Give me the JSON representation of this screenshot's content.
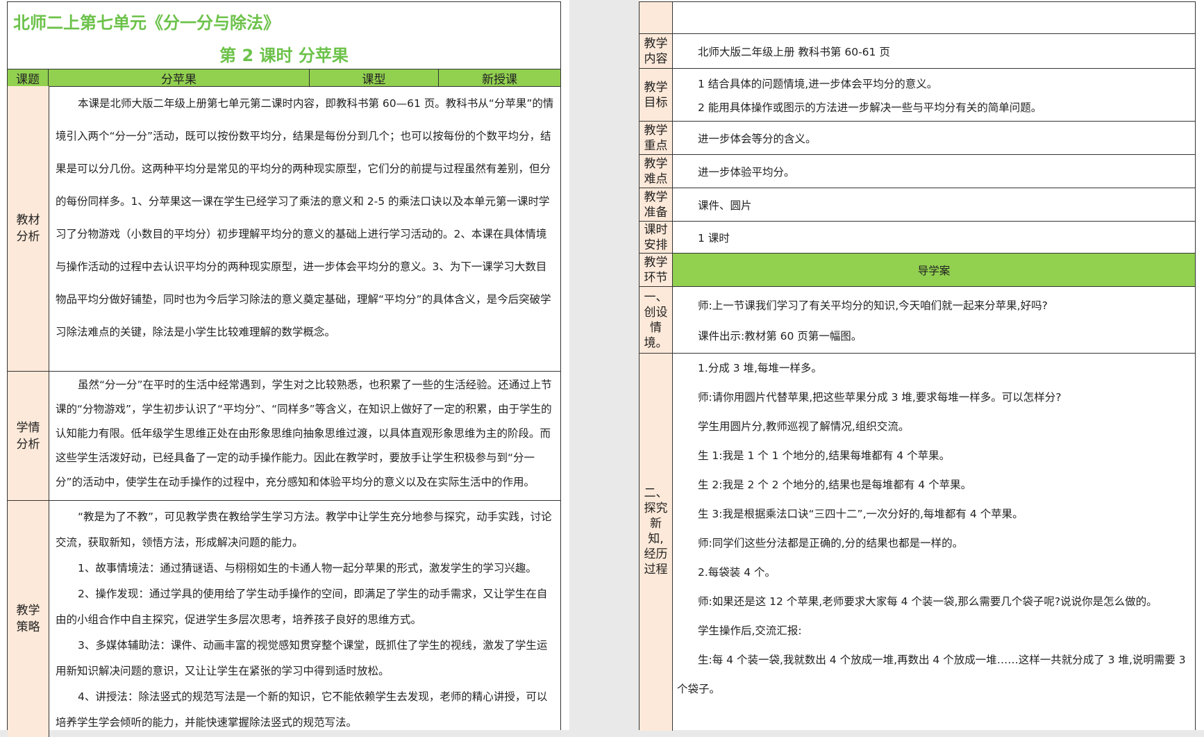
{
  "left": {
    "doc_title": "北师二上第七单元《分一分与除法》",
    "lesson_title": "第 2 课时  分苹果",
    "header": {
      "topic_label": "课题",
      "topic_value": "分苹果",
      "type_label": "课型",
      "type_value": "新授课"
    },
    "material": {
      "label": "教材\n分析",
      "text": "本课是北师大版二年级上册第七单元第二课时内容，即教科书第 60—61 页。教科书从“分苹果”的情境引入两个“分一分”活动，既可以按份数平均分，结果是每份分到几个；也可以按每份的个数平均分，结果是可以分几份。这两种平均分是常见的平均分的两种现实原型，它们分的前提与过程虽然有差别，但分的每份同样多。1、分苹果这一课在学生已经学习了乘法的意义和 2-5 的乘法口诀以及本单元第一课时学习了分物游戏（小数目的平均分）初步理解平均分的意义的基础上进行学习活动的。2、本课在具体情境与操作活动的过程中去认识平均分的两种现实原型，进一步体会平均分的意义。3、为下一课学习大数目物品平均分做好铺垫，同时也为今后学习除法的意义奠定基础，理解“平均分”的具体含义，是今后突破学习除法难点的关键，除法是小学生比较难理解的数学概念。"
    },
    "students": {
      "label": "学情\n分析",
      "text": "虽然“分一分”在平时的生活中经常遇到，学生对之比较熟悉，也积累了一些的生活经验。还通过上节课的“分物游戏”，学生初步认识了“平均分”、“同样多”等含义，在知识上做好了一定的积累，由于学生的认知能力有限。低年级学生思维正处在由形象思维向抽象思维过渡，以具体直观形象思维为主的阶段。而这些学生活泼好动，已经具备了一定的动手操作能力。因此在教学时，要放手让学生积极参与到“分一分”的活动中，使学生在动手操作的过程中，充分感知和体验平均分的意义以及在实际生活中的作用。"
    },
    "strategy": {
      "label": "教学\n策略",
      "paragraphs": [
        "“教是为了不教”，可见教学贵在教给学生学习方法。教学中让学生充分地参与探究，动手实践，讨论交流，获取新知，领悟方法，形成解决问题的能力。",
        "1、故事情境法：通过猜谜语、与栩栩如生的卡通人物一起分苹果的形式，激发学生的学习兴趣。",
        "2、操作发现：通过学具的使用给了学生动手操作的空间，即满足了学生的动手需求，又让学生在自由的小组合作中自主探究，促进学生多层次思考，培养孩子良好的思维方式。",
        "3、多媒体辅助法：课件、动画丰富的视觉感知贯穿整个课堂，既抓住了学生的视线，激发了学生运用新知识解决问题的意识，又让让学生在紧张的学习中得到适时放松。",
        "4、讲授法：除法竖式的规范写法是一个新的知识，它不能依赖学生去发现，老师的精心讲授，可以培养学生学会倾听的能力，并能快速掌握除法竖式的规范写法。"
      ]
    }
  },
  "right": {
    "rows": [
      {
        "label": "教学\n内容",
        "lines": [
          "北师大版二年级上册  教科书第 60-61 页"
        ]
      },
      {
        "label": "教学\n目标",
        "lines": [
          "1 结合具体的问题情境,进一步体会平均分的意义。",
          "2 能用具体操作或图示的方法进一步解决一些与平均分有关的简单问题。"
        ]
      },
      {
        "label": "教学\n重点",
        "lines": [
          "进一步体会等分的含义。"
        ]
      },
      {
        "label": "教学\n难点",
        "lines": [
          "进一步体验平均分。"
        ]
      },
      {
        "label": "教学\n准备",
        "lines": [
          "课件、圆片"
        ]
      },
      {
        "label": "课时\n安排",
        "lines": [
          "1 课时"
        ]
      }
    ],
    "segment_label": "教学\n环节",
    "segment_title": "导学案",
    "part1": {
      "label": "一、\n创设\n情\n境。",
      "lines": [
        "师:上一节课我们学习了有关平均分的知识,今天咱们就一起来分苹果,好吗?",
        "课件出示:教材第 60 页第一幅图。"
      ]
    },
    "part2": {
      "label": "二、\n探究\n新\n知,\n经历\n过程",
      "lines": [
        "1.分成 3 堆,每堆一样多。",
        "师:请你用圆片代替苹果,把这些苹果分成 3 堆,要求每堆一样多。可以怎样分?",
        "学生用圆片分,教师巡视了解情况,组织交流。",
        "生 1:我是 1 个 1 个地分的,结果每堆都有 4 个苹果。",
        "生 2:我是 2 个 2 个地分的,结果也是每堆都有 4 个苹果。",
        "生 3:我是根据乘法口诀“三四十二”,一次分好的,每堆都有 4 个苹果。",
        "师:同学们这些分法都是正确的,分的结果也都是一样的。",
        "2.每袋装 4 个。",
        "师:如果还是这 12 个苹果,老师要求大家每 4 个装一袋,那么需要几个袋子呢?说说你是怎么做的。",
        "学生操作后,交流汇报:",
        "生:每 4 个装一袋,我就数出 4 个放成一堆,再数出 4 个放成一堆……这样一共就分成了 3 堆,说明需要 3",
        "个袋子。"
      ]
    }
  }
}
